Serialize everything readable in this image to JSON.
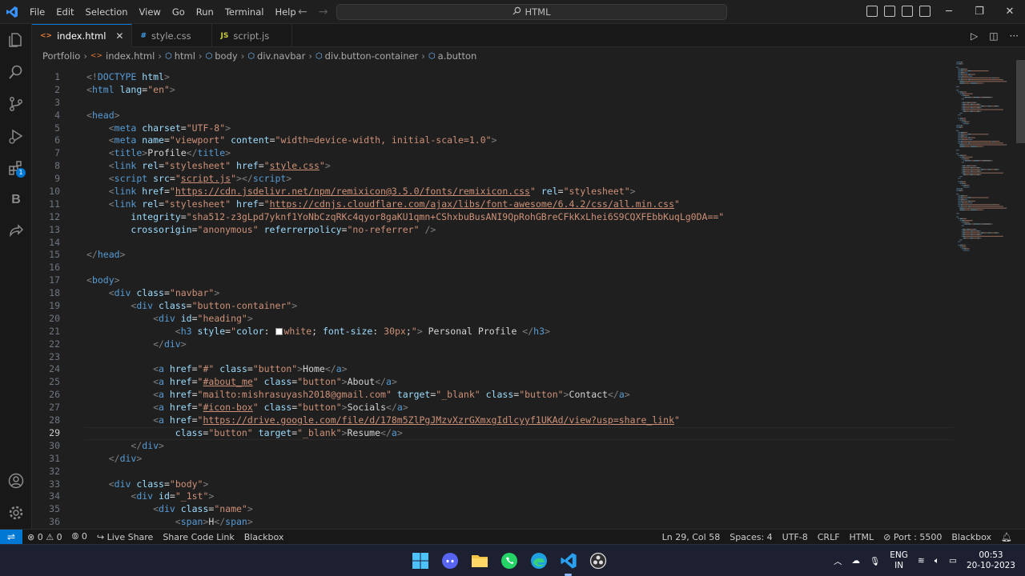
{
  "titlebar": {
    "menu": [
      "File",
      "Edit",
      "Selection",
      "View",
      "Go",
      "Run",
      "Terminal",
      "Help"
    ],
    "search_text": "HTML"
  },
  "tabs": [
    {
      "label": "index.html",
      "icon": "<>",
      "icon_color": "#e37933",
      "active": true
    },
    {
      "label": "style.css",
      "icon": "#",
      "icon_color": "#42a5f5",
      "active": false
    },
    {
      "label": "script.js",
      "icon": "JS",
      "icon_color": "#cbcb41",
      "active": false
    }
  ],
  "breadcrumb": [
    "Portfolio",
    "index.html",
    "html",
    "body",
    "div.navbar",
    "div.button-container",
    "a.button"
  ],
  "editor": {
    "current_line": 29,
    "lines": [
      [
        [
          "br",
          "<!"
        ],
        [
          "tag",
          "DOCTYPE"
        ],
        [
          "txt",
          " "
        ],
        [
          "attr",
          "html"
        ],
        [
          "br",
          ">"
        ]
      ],
      [
        [
          "br",
          "<"
        ],
        [
          "tag",
          "html"
        ],
        [
          "txt",
          " "
        ],
        [
          "attr",
          "lang"
        ],
        [
          "txt",
          "="
        ],
        [
          "str",
          "\"en\""
        ],
        [
          "br",
          ">"
        ]
      ],
      [],
      [
        [
          "br",
          "<"
        ],
        [
          "tag",
          "head"
        ],
        [
          "br",
          ">"
        ]
      ],
      [
        [
          "txt",
          "    "
        ],
        [
          "br",
          "<"
        ],
        [
          "tag",
          "meta"
        ],
        [
          "txt",
          " "
        ],
        [
          "attr",
          "charset"
        ],
        [
          "txt",
          "="
        ],
        [
          "str",
          "\"UTF-8\""
        ],
        [
          "br",
          ">"
        ]
      ],
      [
        [
          "txt",
          "    "
        ],
        [
          "br",
          "<"
        ],
        [
          "tag",
          "meta"
        ],
        [
          "txt",
          " "
        ],
        [
          "attr",
          "name"
        ],
        [
          "txt",
          "="
        ],
        [
          "str",
          "\"viewport\""
        ],
        [
          "txt",
          " "
        ],
        [
          "attr",
          "content"
        ],
        [
          "txt",
          "="
        ],
        [
          "str",
          "\"width=device-width, initial-scale=1.0\""
        ],
        [
          "br",
          ">"
        ]
      ],
      [
        [
          "txt",
          "    "
        ],
        [
          "br",
          "<"
        ],
        [
          "tag",
          "title"
        ],
        [
          "br",
          ">"
        ],
        [
          "txt",
          "Profile"
        ],
        [
          "br",
          "</"
        ],
        [
          "tag",
          "title"
        ],
        [
          "br",
          ">"
        ]
      ],
      [
        [
          "txt",
          "    "
        ],
        [
          "br",
          "<"
        ],
        [
          "tag",
          "link"
        ],
        [
          "txt",
          " "
        ],
        [
          "attr",
          "rel"
        ],
        [
          "txt",
          "="
        ],
        [
          "str",
          "\"stylesheet\""
        ],
        [
          "txt",
          " "
        ],
        [
          "attr",
          "href"
        ],
        [
          "txt",
          "="
        ],
        [
          "str",
          "\""
        ],
        [
          "strl",
          "style.css"
        ],
        [
          "str",
          "\""
        ],
        [
          "br",
          ">"
        ]
      ],
      [
        [
          "txt",
          "    "
        ],
        [
          "br",
          "<"
        ],
        [
          "tag",
          "script"
        ],
        [
          "txt",
          " "
        ],
        [
          "attr",
          "src"
        ],
        [
          "txt",
          "="
        ],
        [
          "str",
          "\""
        ],
        [
          "strl",
          "script.js"
        ],
        [
          "str",
          "\""
        ],
        [
          "br",
          "></"
        ],
        [
          "tag",
          "script"
        ],
        [
          "br",
          ">"
        ]
      ],
      [
        [
          "txt",
          "    "
        ],
        [
          "br",
          "<"
        ],
        [
          "tag",
          "link"
        ],
        [
          "txt",
          " "
        ],
        [
          "attr",
          "href"
        ],
        [
          "txt",
          "="
        ],
        [
          "str",
          "\""
        ],
        [
          "strl",
          "https://cdn.jsdelivr.net/npm/remixicon@3.5.0/fonts/remixicon.css"
        ],
        [
          "str",
          "\""
        ],
        [
          "txt",
          " "
        ],
        [
          "attr",
          "rel"
        ],
        [
          "txt",
          "="
        ],
        [
          "str",
          "\"stylesheet\""
        ],
        [
          "br",
          ">"
        ]
      ],
      [
        [
          "txt",
          "    "
        ],
        [
          "br",
          "<"
        ],
        [
          "tag",
          "link"
        ],
        [
          "txt",
          " "
        ],
        [
          "attr",
          "rel"
        ],
        [
          "txt",
          "="
        ],
        [
          "str",
          "\"stylesheet\""
        ],
        [
          "txt",
          " "
        ],
        [
          "attr",
          "href"
        ],
        [
          "txt",
          "="
        ],
        [
          "str",
          "\""
        ],
        [
          "strl",
          "https://cdnjs.cloudflare.com/ajax/libs/font-awesome/6.4.2/css/all.min.css"
        ],
        [
          "str",
          "\""
        ]
      ],
      [
        [
          "txt",
          "        "
        ],
        [
          "attr",
          "integrity"
        ],
        [
          "txt",
          "="
        ],
        [
          "str",
          "\"sha512-z3gLpd7yknf1YoNbCzqRKc4qyor8gaKU1qmn+CShxbuBusANI9QpRohGBreCFkKxLhei6S9CQXFEbbKuqLg0DA==\""
        ]
      ],
      [
        [
          "txt",
          "        "
        ],
        [
          "attr",
          "crossorigin"
        ],
        [
          "txt",
          "="
        ],
        [
          "str",
          "\"anonymous\""
        ],
        [
          "txt",
          " "
        ],
        [
          "attr",
          "referrerpolicy"
        ],
        [
          "txt",
          "="
        ],
        [
          "str",
          "\"no-referrer\""
        ],
        [
          "txt",
          " "
        ],
        [
          "br",
          "/>"
        ]
      ],
      [],
      [
        [
          "br",
          "</"
        ],
        [
          "tag",
          "head"
        ],
        [
          "br",
          ">"
        ]
      ],
      [],
      [
        [
          "br",
          "<"
        ],
        [
          "tag",
          "body"
        ],
        [
          "br",
          ">"
        ]
      ],
      [
        [
          "txt",
          "    "
        ],
        [
          "br",
          "<"
        ],
        [
          "tag",
          "div"
        ],
        [
          "txt",
          " "
        ],
        [
          "attr",
          "class"
        ],
        [
          "txt",
          "="
        ],
        [
          "str",
          "\"navbar\""
        ],
        [
          "br",
          ">"
        ]
      ],
      [
        [
          "txt",
          "        "
        ],
        [
          "br",
          "<"
        ],
        [
          "tag",
          "div"
        ],
        [
          "txt",
          " "
        ],
        [
          "attr",
          "class"
        ],
        [
          "txt",
          "="
        ],
        [
          "str",
          "\"button-container\""
        ],
        [
          "br",
          ">"
        ]
      ],
      [
        [
          "txt",
          "            "
        ],
        [
          "br",
          "<"
        ],
        [
          "tag",
          "div"
        ],
        [
          "txt",
          " "
        ],
        [
          "attr",
          "id"
        ],
        [
          "txt",
          "="
        ],
        [
          "str",
          "\"heading\""
        ],
        [
          "br",
          ">"
        ]
      ],
      [
        [
          "txt",
          "                "
        ],
        [
          "br",
          "<"
        ],
        [
          "tag",
          "h3"
        ],
        [
          "txt",
          " "
        ],
        [
          "attr",
          "style"
        ],
        [
          "txt",
          "="
        ],
        [
          "str",
          "\""
        ],
        [
          "attr",
          "color"
        ],
        [
          "txt",
          ": "
        ],
        [
          "swatch",
          ""
        ],
        [
          "str",
          "white"
        ],
        [
          "txt",
          "; "
        ],
        [
          "attr",
          "font-size"
        ],
        [
          "txt",
          ": "
        ],
        [
          "str",
          "30px"
        ],
        [
          "txt",
          ";"
        ],
        [
          "str",
          "\""
        ],
        [
          "br",
          ">"
        ],
        [
          "txt",
          " Personal Profile "
        ],
        [
          "br",
          "</"
        ],
        [
          "tag",
          "h3"
        ],
        [
          "br",
          ">"
        ]
      ],
      [
        [
          "txt",
          "            "
        ],
        [
          "br",
          "</"
        ],
        [
          "tag",
          "div"
        ],
        [
          "br",
          ">"
        ]
      ],
      [],
      [
        [
          "txt",
          "            "
        ],
        [
          "br",
          "<"
        ],
        [
          "tag",
          "a"
        ],
        [
          "txt",
          " "
        ],
        [
          "attr",
          "href"
        ],
        [
          "txt",
          "="
        ],
        [
          "str",
          "\"#\""
        ],
        [
          "txt",
          " "
        ],
        [
          "attr",
          "class"
        ],
        [
          "txt",
          "="
        ],
        [
          "str",
          "\"button\""
        ],
        [
          "br",
          ">"
        ],
        [
          "txt",
          "Home"
        ],
        [
          "br",
          "</"
        ],
        [
          "tag",
          "a"
        ],
        [
          "br",
          ">"
        ]
      ],
      [
        [
          "txt",
          "            "
        ],
        [
          "br",
          "<"
        ],
        [
          "tag",
          "a"
        ],
        [
          "txt",
          " "
        ],
        [
          "attr",
          "href"
        ],
        [
          "txt",
          "="
        ],
        [
          "str",
          "\""
        ],
        [
          "strl",
          "#about_me"
        ],
        [
          "str",
          "\""
        ],
        [
          "txt",
          " "
        ],
        [
          "attr",
          "class"
        ],
        [
          "txt",
          "="
        ],
        [
          "str",
          "\"button\""
        ],
        [
          "br",
          ">"
        ],
        [
          "txt",
          "About"
        ],
        [
          "br",
          "</"
        ],
        [
          "tag",
          "a"
        ],
        [
          "br",
          ">"
        ]
      ],
      [
        [
          "txt",
          "            "
        ],
        [
          "br",
          "<"
        ],
        [
          "tag",
          "a"
        ],
        [
          "txt",
          " "
        ],
        [
          "attr",
          "href"
        ],
        [
          "txt",
          "="
        ],
        [
          "str",
          "\"mailto:mishrasuyash2018@gmail.com\""
        ],
        [
          "txt",
          " "
        ],
        [
          "attr",
          "target"
        ],
        [
          "txt",
          "="
        ],
        [
          "str",
          "\"_blank\""
        ],
        [
          "txt",
          " "
        ],
        [
          "attr",
          "class"
        ],
        [
          "txt",
          "="
        ],
        [
          "str",
          "\"button\""
        ],
        [
          "br",
          ">"
        ],
        [
          "txt",
          "Contact"
        ],
        [
          "br",
          "</"
        ],
        [
          "tag",
          "a"
        ],
        [
          "br",
          ">"
        ]
      ],
      [
        [
          "txt",
          "            "
        ],
        [
          "br",
          "<"
        ],
        [
          "tag",
          "a"
        ],
        [
          "txt",
          " "
        ],
        [
          "attr",
          "href"
        ],
        [
          "txt",
          "="
        ],
        [
          "str",
          "\""
        ],
        [
          "strl",
          "#icon-box"
        ],
        [
          "str",
          "\""
        ],
        [
          "txt",
          " "
        ],
        [
          "attr",
          "class"
        ],
        [
          "txt",
          "="
        ],
        [
          "str",
          "\"button\""
        ],
        [
          "br",
          ">"
        ],
        [
          "txt",
          "Socials"
        ],
        [
          "br",
          "</"
        ],
        [
          "tag",
          "a"
        ],
        [
          "br",
          ">"
        ]
      ],
      [
        [
          "txt",
          "            "
        ],
        [
          "br",
          "<"
        ],
        [
          "tag",
          "a"
        ],
        [
          "txt",
          " "
        ],
        [
          "attr",
          "href"
        ],
        [
          "txt",
          "="
        ],
        [
          "str",
          "\""
        ],
        [
          "strl",
          "https://drive.google.com/file/d/178m5ZlPgJMzvXzrGXmxgIdlcyyf1UKAd/view?usp=share_link"
        ],
        [
          "str",
          "\""
        ]
      ],
      [
        [
          "txt",
          "                "
        ],
        [
          "attr",
          "class"
        ],
        [
          "txt",
          "="
        ],
        [
          "str",
          "\"button\""
        ],
        [
          "txt",
          " "
        ],
        [
          "attr",
          "target"
        ],
        [
          "txt",
          "="
        ],
        [
          "str",
          "\"_blank\""
        ],
        [
          "br",
          ">"
        ],
        [
          "txt",
          "Resume"
        ],
        [
          "br",
          "</"
        ],
        [
          "tag",
          "a"
        ],
        [
          "br",
          ">"
        ]
      ],
      [
        [
          "txt",
          "        "
        ],
        [
          "br",
          "</"
        ],
        [
          "tag",
          "div"
        ],
        [
          "br",
          ">"
        ]
      ],
      [
        [
          "txt",
          "    "
        ],
        [
          "br",
          "</"
        ],
        [
          "tag",
          "div"
        ],
        [
          "br",
          ">"
        ]
      ],
      [],
      [
        [
          "txt",
          "    "
        ],
        [
          "br",
          "<"
        ],
        [
          "tag",
          "div"
        ],
        [
          "txt",
          " "
        ],
        [
          "attr",
          "class"
        ],
        [
          "txt",
          "="
        ],
        [
          "str",
          "\"body\""
        ],
        [
          "br",
          ">"
        ]
      ],
      [
        [
          "txt",
          "        "
        ],
        [
          "br",
          "<"
        ],
        [
          "tag",
          "div"
        ],
        [
          "txt",
          " "
        ],
        [
          "attr",
          "id"
        ],
        [
          "txt",
          "="
        ],
        [
          "str",
          "\"_1st\""
        ],
        [
          "br",
          ">"
        ]
      ],
      [
        [
          "txt",
          "            "
        ],
        [
          "br",
          "<"
        ],
        [
          "tag",
          "div"
        ],
        [
          "txt",
          " "
        ],
        [
          "attr",
          "class"
        ],
        [
          "txt",
          "="
        ],
        [
          "str",
          "\"name\""
        ],
        [
          "br",
          ">"
        ]
      ],
      [
        [
          "txt",
          "                "
        ],
        [
          "br",
          "<"
        ],
        [
          "tag",
          "span"
        ],
        [
          "br",
          ">"
        ],
        [
          "txt",
          "H"
        ],
        [
          "br",
          "</"
        ],
        [
          "tag",
          "span"
        ],
        [
          "br",
          ">"
        ]
      ]
    ]
  },
  "statusbar": {
    "errors": "0",
    "warnings": "0",
    "ports": "0",
    "live_share": "Live Share",
    "share_code_link": "Share Code Link",
    "blackbox_left": "Blackbox",
    "position": "Ln 29, Col 58",
    "spaces": "Spaces: 4",
    "encoding": "UTF-8",
    "eol": "CRLF",
    "language": "HTML",
    "port": "Port : 5500",
    "blackbox_right": "Blackbox"
  },
  "taskbar": {
    "lang_top": "ENG",
    "lang_bottom": "IN",
    "time": "00:53",
    "date": "20-10-2023"
  },
  "colors": {
    "accent": "#0078d4",
    "tag": "#569cd6",
    "attr": "#9cdcfe",
    "string": "#ce9178",
    "text": "#d4d4d4"
  }
}
